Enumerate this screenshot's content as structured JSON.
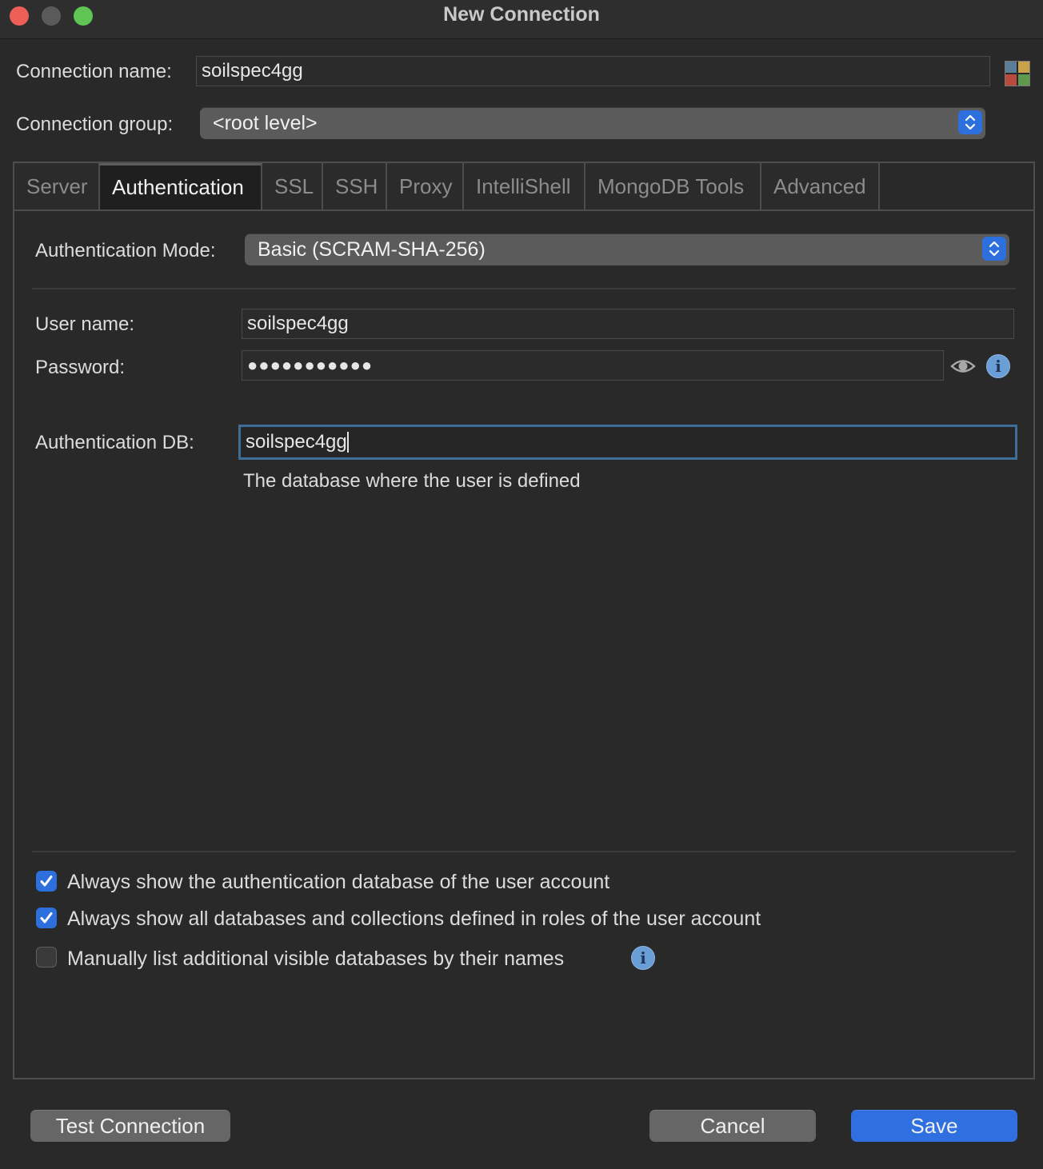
{
  "window": {
    "title": "New Connection"
  },
  "connection": {
    "name_label": "Connection name:",
    "name_value": "soilspec4gg",
    "group_label": "Connection group:",
    "group_value": "<root level>"
  },
  "tabs": [
    {
      "label": "Server"
    },
    {
      "label": "Authentication"
    },
    {
      "label": "SSL"
    },
    {
      "label": "SSH"
    },
    {
      "label": "Proxy"
    },
    {
      "label": "IntelliShell"
    },
    {
      "label": "MongoDB Tools"
    },
    {
      "label": "Advanced"
    }
  ],
  "auth": {
    "mode_label": "Authentication Mode:",
    "mode_value": "Basic (SCRAM-SHA-256)",
    "user_label": "User name:",
    "user_value": "soilspec4gg",
    "password_label": "Password:",
    "password_value": "●●●●●●●●●●●",
    "db_label": "Authentication DB:",
    "db_value": "soilspec4gg",
    "db_hint": "The database where the user is defined"
  },
  "options": [
    {
      "label": "Always show the authentication database of the user account",
      "checked": true
    },
    {
      "label": "Always show all databases and collections defined in roles of the user account",
      "checked": true
    },
    {
      "label": "Manually list additional visible databases by their names",
      "checked": false
    }
  ],
  "buttons": {
    "test": "Test Connection",
    "cancel": "Cancel",
    "save": "Save"
  },
  "colors": {
    "accent": "#2f6fe0",
    "close": "#ed5f57",
    "maximize": "#5fc454"
  },
  "icons": [
    "color-grid-icon",
    "stepper-icon",
    "eye-icon",
    "info-icon",
    "checkmark-icon"
  ]
}
